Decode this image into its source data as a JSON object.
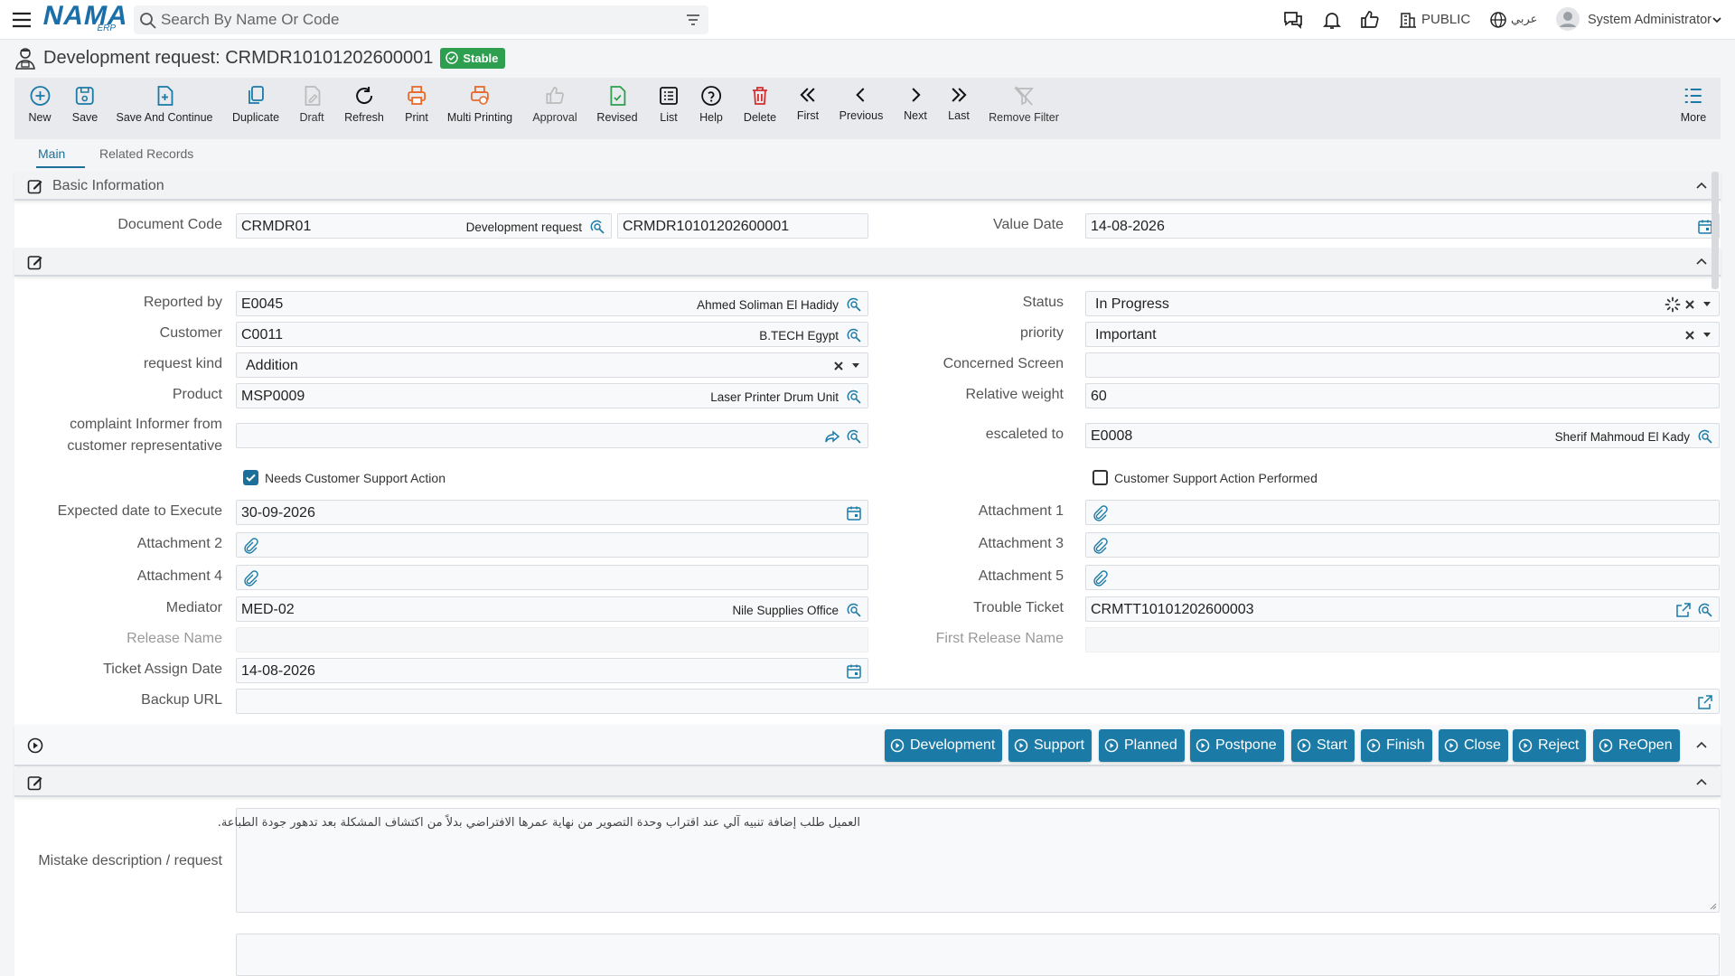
{
  "app": {
    "logo": "NAMA",
    "logo_sub": "ERP",
    "search_placeholder": "Search By Name Or Code",
    "visibility": "PUBLIC",
    "language": "عربي",
    "user": "System Administrator"
  },
  "page": {
    "title": "Development request: CRMDR10101202600001",
    "status_badge": "Stable"
  },
  "toolbar": {
    "new": "New",
    "save": "Save",
    "save_continue": "Save And Continue",
    "duplicate": "Duplicate",
    "draft": "Draft",
    "refresh": "Refresh",
    "print": "Print",
    "multi_printing": "Multi Printing",
    "approval": "Approval",
    "revised": "Revised",
    "list": "List",
    "help": "Help",
    "delete": "Delete",
    "first": "First",
    "previous": "Previous",
    "next": "Next",
    "last": "Last",
    "remove_filter": "Remove Filter",
    "more": "More"
  },
  "tabs": {
    "main": "Main",
    "related": "Related Records"
  },
  "basic": {
    "section_title": "Basic Information",
    "document_code_label": "Document Code",
    "document_code": "CRMDR01",
    "document_type": "Development request",
    "document_number": "CRMDR10101202600001",
    "value_date_label": "Value Date",
    "value_date": "14-08-2026"
  },
  "details": {
    "reported_by_label": "Reported by",
    "reported_by_code": "E0045",
    "reported_by_name": "Ahmed Soliman El Hadidy",
    "customer_label": "Customer",
    "customer_code": "C0011",
    "customer_name": "B.TECH Egypt",
    "request_kind_label": "request kind",
    "request_kind": "Addition",
    "product_label": "Product",
    "product_code": "MSP0009",
    "product_name": "Laser Printer Drum Unit",
    "informer_label_1": "complaint Informer from",
    "informer_label_2": "customer representative",
    "needs_support_label": "Needs Customer Support Action",
    "expected_date_label": "Expected date to Execute",
    "expected_date": "30-09-2026",
    "attachment2_label": "Attachment 2",
    "attachment4_label": "Attachment 4",
    "mediator_label": "Mediator",
    "mediator_code": "MED-02",
    "mediator_name": "Nile Supplies Office",
    "release_name_label": "Release Name",
    "ticket_assign_date_label": "Ticket Assign Date",
    "ticket_assign_date": "14-08-2026",
    "backup_url_label": "Backup URL",
    "status_label": "Status",
    "status": "In Progress",
    "priority_label": "priority",
    "priority": "Important",
    "concerned_screen_label": "Concerned Screen",
    "relative_weight_label": "Relative weight",
    "relative_weight": "60",
    "escalated_label": "escaleted to",
    "escalated_code": "E0008",
    "escalated_name": "Sherif Mahmoud El Kady",
    "support_performed_label": "Customer Support Action Performed",
    "attachment1_label": "Attachment 1",
    "attachment3_label": "Attachment 3",
    "attachment5_label": "Attachment 5",
    "trouble_ticket_label": "Trouble Ticket",
    "trouble_ticket": "CRMTT10101202600003",
    "first_release_label": "First Release Name"
  },
  "actions": {
    "development": "Development",
    "support": "Support",
    "planned": "Planned",
    "postpone": "Postpone",
    "start": "Start",
    "finish": "Finish",
    "close": "Close",
    "reject": "Reject",
    "reopen": "ReOpen"
  },
  "description": {
    "label": "Mistake description / request",
    "text": "العميل طلب إضافة تنبيه آلي عند اقتراب وحدة التصوير من نهاية عمرها الافتراضي بدلاً من اكتشاف المشكلة بعد تدهور جودة الطباعة."
  },
  "colors": {
    "primary": "#1b7aa6",
    "stable": "#2e9e4f",
    "orange": "#e8692a"
  }
}
